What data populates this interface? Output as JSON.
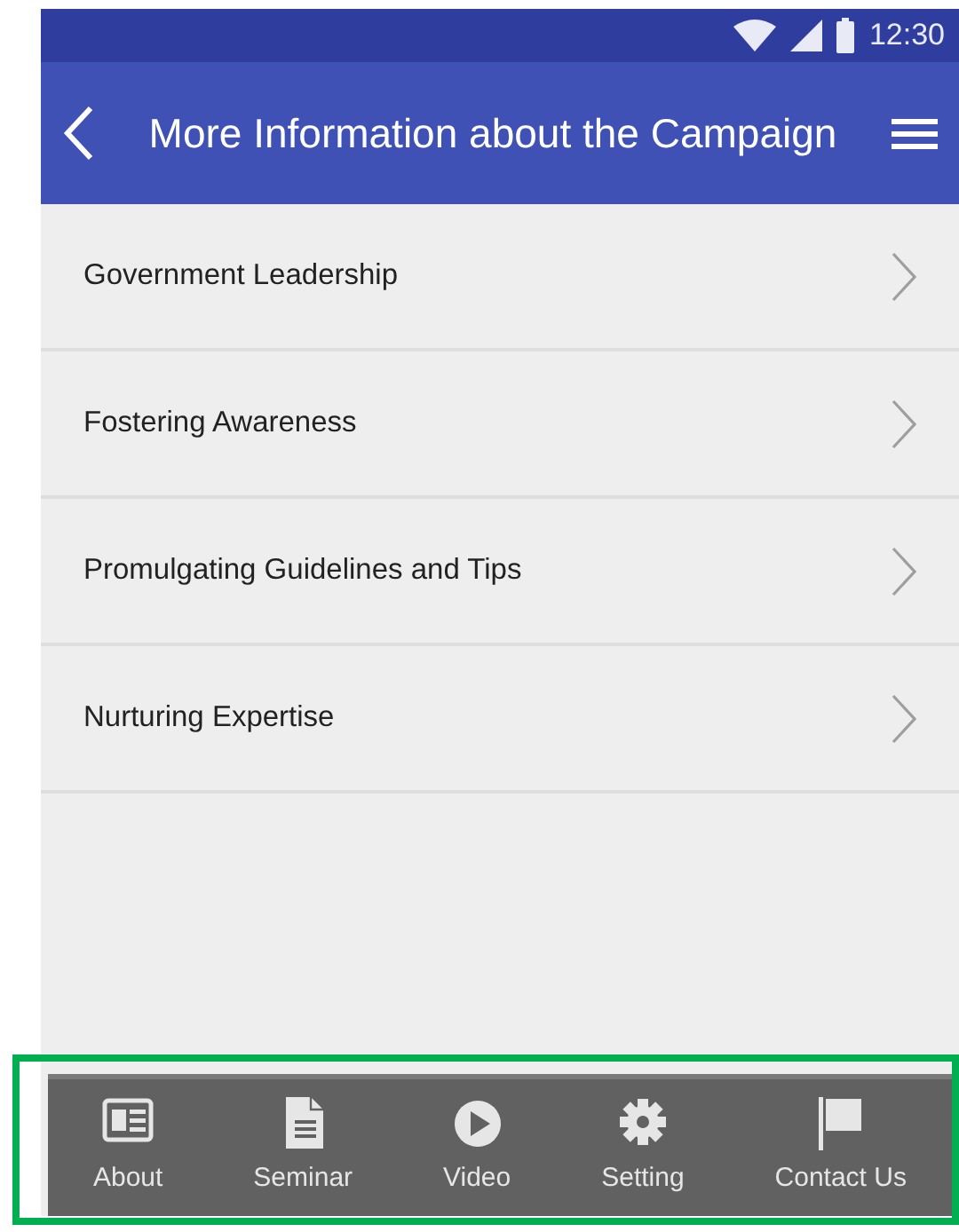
{
  "status_bar": {
    "time": "12:30"
  },
  "app_bar": {
    "title": "More Information about the Campaign"
  },
  "items": [
    {
      "label": "Government Leadership"
    },
    {
      "label": "Fostering Awareness"
    },
    {
      "label": "Promulgating Guidelines and Tips"
    },
    {
      "label": "Nurturing Expertise"
    }
  ],
  "tab_bar": [
    {
      "label": "About",
      "kind": "news"
    },
    {
      "label": "Seminar",
      "kind": "document"
    },
    {
      "label": "Video",
      "kind": "play"
    },
    {
      "label": "Setting",
      "kind": "gear"
    },
    {
      "label": "Contact Us",
      "kind": "flag"
    }
  ]
}
